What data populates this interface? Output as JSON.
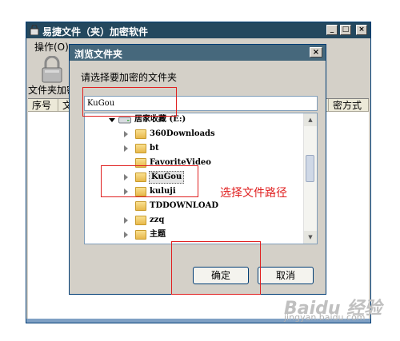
{
  "main_window": {
    "title": "易捷文件（夹）加密软件",
    "menu": "操作(O)",
    "toolbar_label": "文件夹加密",
    "columns": [
      "序号",
      "文",
      "密方式"
    ]
  },
  "dialog": {
    "title": "浏览文件夹",
    "prompt": "请选择要加密的文件夹",
    "path_value": "KuGou",
    "tree": [
      {
        "label": "居家收藏 (E:)",
        "type": "drive",
        "expanded": true
      },
      {
        "label": "360Downloads",
        "type": "folder"
      },
      {
        "label": "bt",
        "type": "folder"
      },
      {
        "label": "FavoriteVideo",
        "type": "folder"
      },
      {
        "label": "KuGou",
        "type": "folder",
        "selected": true
      },
      {
        "label": "kuluji",
        "type": "folder"
      },
      {
        "label": "TDDOWNLOAD",
        "type": "folder"
      },
      {
        "label": "zzq",
        "type": "folder"
      },
      {
        "label": "主题",
        "type": "folder"
      }
    ],
    "ok_label": "确定",
    "cancel_label": "取消"
  },
  "annotation": {
    "note": "选择文件路径",
    "color": "#e02020"
  },
  "watermark": {
    "logo": "Baidu 经验",
    "url": "jingyan.baidu.com"
  }
}
